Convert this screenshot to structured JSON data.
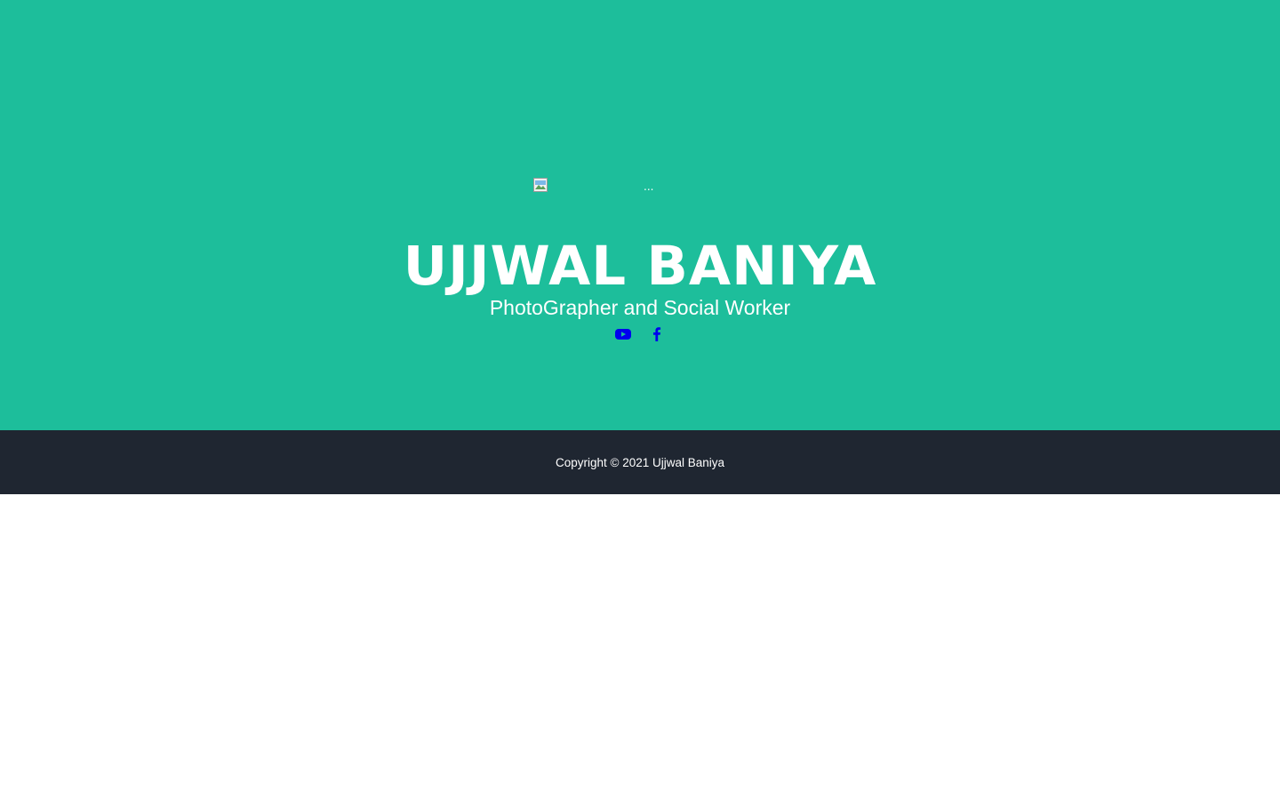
{
  "masthead": {
    "image_alt": "...",
    "title": "UJJWAL BANIYA",
    "subtitle": "PhotoGrapher and Social Worker",
    "social_icons": [
      "youtube-icon",
      "facebook-icon"
    ]
  },
  "footer": {
    "copyright": "Copyright © 2021 Ujjwal Baniya"
  },
  "colors": {
    "masthead_bg": "#1dbe9b",
    "footer_bg": "#1f2631",
    "link": "#0000ee",
    "text": "#ffffff"
  }
}
